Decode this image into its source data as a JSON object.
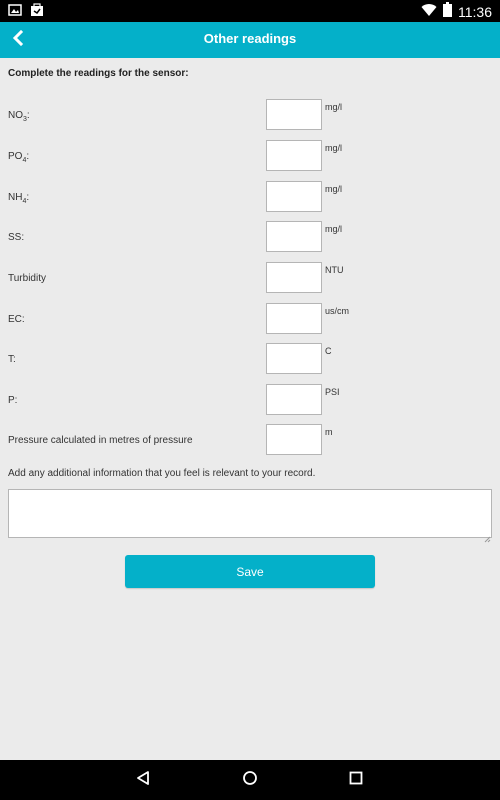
{
  "status_bar": {
    "time": "11:36",
    "icons_left": [
      "image-notification-icon",
      "work-notification-icon"
    ],
    "icons_right": [
      "wifi-icon",
      "battery-icon"
    ]
  },
  "app_bar": {
    "title": "Other readings",
    "back_icon": "chevron-left-icon",
    "color": "#04b0c9"
  },
  "form": {
    "intro": "Complete the readings for the sensor:",
    "readings": [
      {
        "id": "no3",
        "label_main": "NO",
        "label_sub": "3",
        "label_suffix": ":",
        "value": "",
        "unit": "mg/l"
      },
      {
        "id": "po4",
        "label_main": "PO",
        "label_sub": "4",
        "label_suffix": ":",
        "value": "",
        "unit": "mg/l"
      },
      {
        "id": "nh4",
        "label_main": "NH",
        "label_sub": "4",
        "label_suffix": ":",
        "value": "",
        "unit": "mg/l"
      },
      {
        "id": "ss",
        "label_main": "SS:",
        "label_sub": "",
        "label_suffix": "",
        "value": "",
        "unit": "mg/l"
      },
      {
        "id": "turbidity",
        "label_main": "Turbidity",
        "label_sub": "",
        "label_suffix": "",
        "value": "",
        "unit": "NTU"
      },
      {
        "id": "ec",
        "label_main": "EC:",
        "label_sub": "",
        "label_suffix": "",
        "value": "",
        "unit": "us/cm"
      },
      {
        "id": "t",
        "label_main": "T:",
        "label_sub": "",
        "label_suffix": "",
        "value": "",
        "unit": "C"
      },
      {
        "id": "p",
        "label_main": "P:",
        "label_sub": "",
        "label_suffix": "",
        "value": "",
        "unit": "PSI"
      },
      {
        "id": "pressure_m",
        "label_main": "Pressure calculated in metres of pressure",
        "label_sub": "",
        "label_suffix": "",
        "value": "",
        "unit": "m"
      }
    ],
    "notes_label": "Add any additional information that you feel is relevant to your record.",
    "notes_value": "",
    "save_label": "Save"
  },
  "nav_bar": {
    "buttons": [
      "back-triangle-icon",
      "home-circle-icon",
      "recents-square-icon"
    ]
  }
}
